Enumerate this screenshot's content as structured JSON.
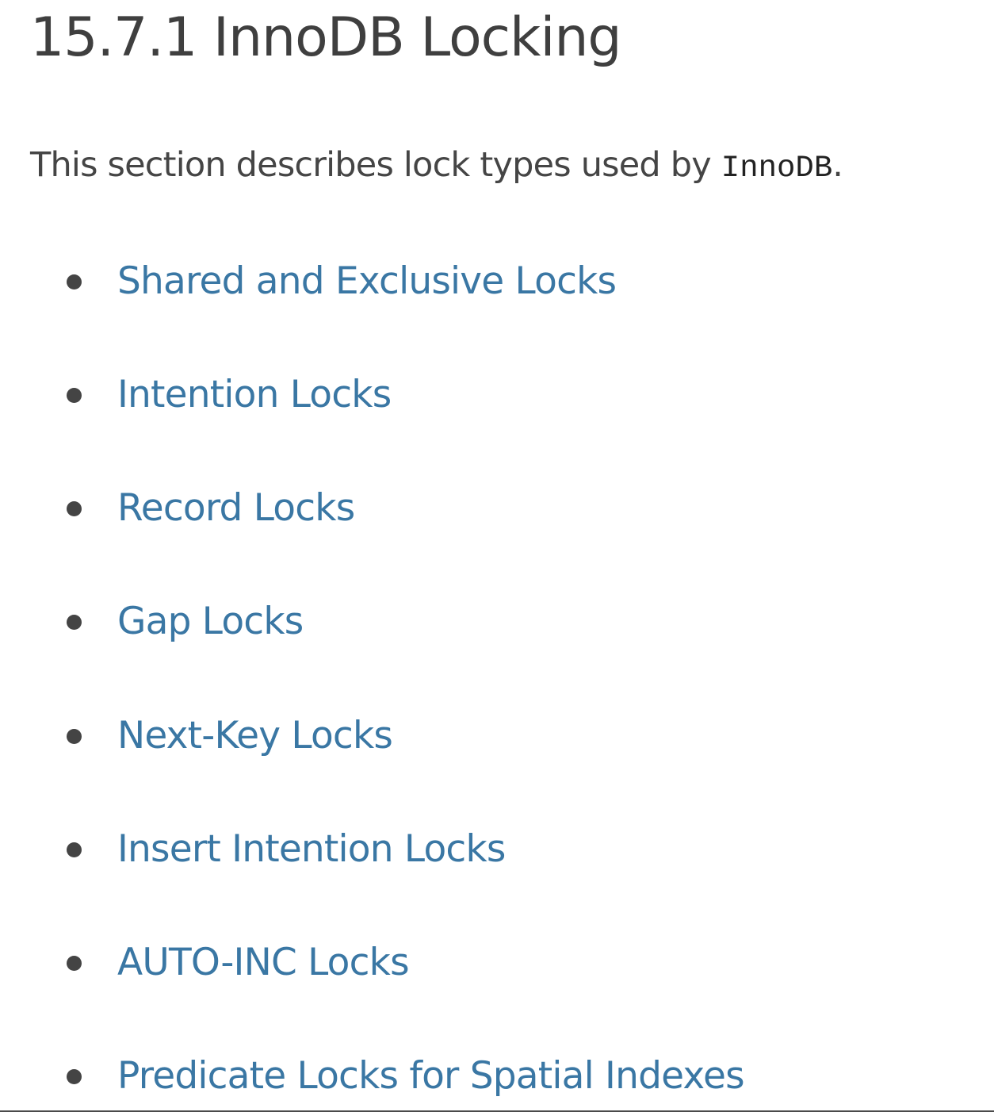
{
  "page": {
    "title": "15.7.1 InnoDB Locking",
    "intro_before": "This section describes lock types used by ",
    "intro_code": "InnoDB",
    "intro_after": "."
  },
  "lock_types": [
    {
      "label": "Shared and Exclusive Locks"
    },
    {
      "label": "Intention Locks"
    },
    {
      "label": "Record Locks"
    },
    {
      "label": "Gap Locks"
    },
    {
      "label": "Next-Key Locks"
    },
    {
      "label": "Insert Intention Locks"
    },
    {
      "label": "AUTO-INC Locks"
    },
    {
      "label": "Predicate Locks for Spatial Indexes"
    }
  ],
  "colors": {
    "link": "#3a77a4",
    "heading": "#3f3f3f",
    "text": "#454545"
  }
}
